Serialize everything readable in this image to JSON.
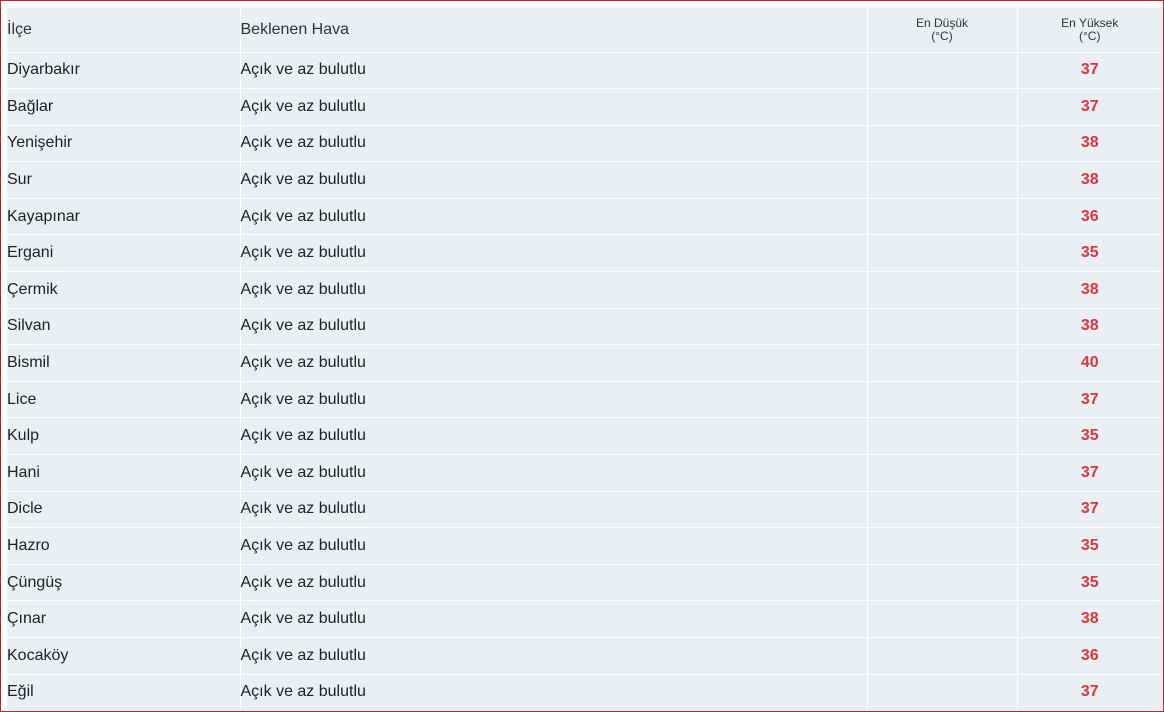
{
  "table": {
    "headers": {
      "district": "İlçe",
      "weather": "Beklenen Hava",
      "min_line1": "En Düşük",
      "min_line2": "(°C)",
      "max_line1": "En Yüksek",
      "max_line2": "(°C)"
    },
    "rows": [
      {
        "district": "Diyarbakır",
        "weather": "Açık ve az bulutlu",
        "min": "",
        "max": "37"
      },
      {
        "district": "Bağlar",
        "weather": "Açık ve az bulutlu",
        "min": "",
        "max": "37"
      },
      {
        "district": "Yenişehir",
        "weather": "Açık ve az bulutlu",
        "min": "",
        "max": "38"
      },
      {
        "district": "Sur",
        "weather": "Açık ve az bulutlu",
        "min": "",
        "max": "38"
      },
      {
        "district": "Kayapınar",
        "weather": "Açık ve az bulutlu",
        "min": "",
        "max": "36"
      },
      {
        "district": "Ergani",
        "weather": "Açık ve az bulutlu",
        "min": "",
        "max": "35"
      },
      {
        "district": "Çermik",
        "weather": "Açık ve az bulutlu",
        "min": "",
        "max": "38"
      },
      {
        "district": "Silvan",
        "weather": "Açık ve az bulutlu",
        "min": "",
        "max": "38"
      },
      {
        "district": "Bismil",
        "weather": "Açık ve az bulutlu",
        "min": "",
        "max": "40"
      },
      {
        "district": "Lice",
        "weather": "Açık ve az bulutlu",
        "min": "",
        "max": "37"
      },
      {
        "district": "Kulp",
        "weather": "Açık ve az bulutlu",
        "min": "",
        "max": "35"
      },
      {
        "district": "Hani",
        "weather": "Açık ve az bulutlu",
        "min": "",
        "max": "37"
      },
      {
        "district": "Dicle",
        "weather": "Açık ve az bulutlu",
        "min": "",
        "max": "37"
      },
      {
        "district": "Hazro",
        "weather": "Açık ve az bulutlu",
        "min": "",
        "max": "35"
      },
      {
        "district": "Çüngüş",
        "weather": "Açık ve az bulutlu",
        "min": "",
        "max": "35"
      },
      {
        "district": "Çınar",
        "weather": "Açık ve az bulutlu",
        "min": "",
        "max": "38"
      },
      {
        "district": "Kocaköy",
        "weather": "Açık ve az bulutlu",
        "min": "",
        "max": "36"
      },
      {
        "district": "Eğil",
        "weather": "Açık ve az bulutlu",
        "min": "",
        "max": "37"
      }
    ]
  },
  "colors": {
    "frame_border": "#c8202b",
    "row_background": "#e9eff2",
    "max_temp_text": "#d9363e"
  }
}
